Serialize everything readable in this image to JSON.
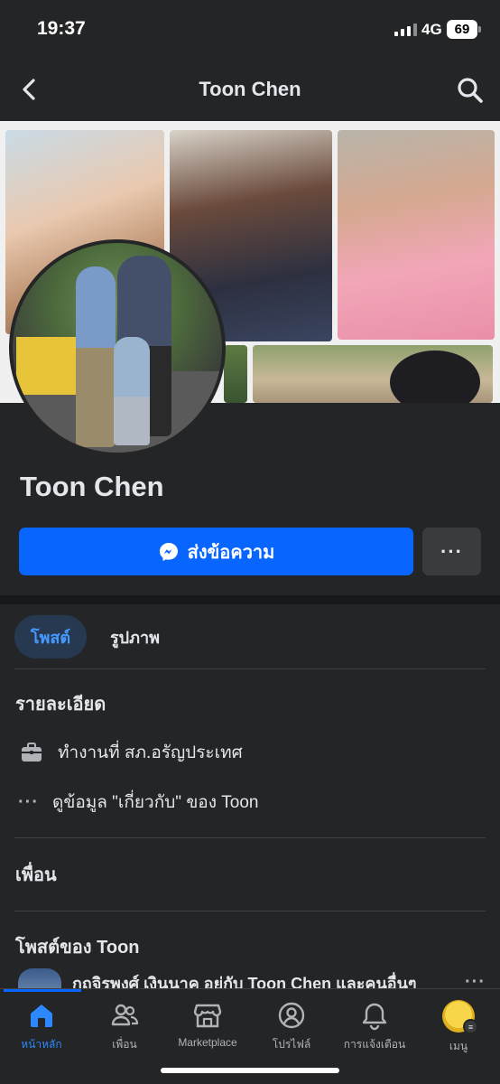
{
  "status_bar": {
    "time": "19:37",
    "network": "4G",
    "battery": "69"
  },
  "header": {
    "title": "Toon Chen",
    "back_icon": "chevron-left-icon",
    "search_icon": "search-icon"
  },
  "profile": {
    "name": "Toon Chen"
  },
  "actions": {
    "message_label": "ส่งข้อความ",
    "message_icon": "messenger-icon",
    "more_label": "···"
  },
  "tabs": [
    {
      "label": "โพสต์",
      "active": true
    },
    {
      "label": "รูปภาพ",
      "active": false
    }
  ],
  "details": {
    "title": "รายละเอียด",
    "work": "ทำงานที่ สภ.อรัญประเทศ",
    "work_icon": "briefcase-icon",
    "about_dots": "···",
    "about": "ดูข้อมูล \"เกี่ยวกับ\" ของ Toon"
  },
  "friends": {
    "title": "เพื่อน"
  },
  "posts": {
    "title": "โพสต์ของ Toon",
    "first_author": "กฤจิรพงศ์ เงินนาค อยู่กับ Toon Chen และคนอื่นๆ",
    "more": "···"
  },
  "bottom_nav": [
    {
      "label": "หน้าหลัก",
      "icon": "home-icon",
      "active": true
    },
    {
      "label": "เพื่อน",
      "icon": "friends-icon",
      "active": false
    },
    {
      "label": "Marketplace",
      "icon": "marketplace-icon",
      "active": false
    },
    {
      "label": "โปรไฟล์",
      "icon": "profile-icon",
      "active": false
    },
    {
      "label": "การแจ้งเตือน",
      "icon": "bell-icon",
      "active": false
    },
    {
      "label": "เมนู",
      "icon": "menu-avatar-icon",
      "active": false
    }
  ],
  "colors": {
    "background": "#242526",
    "accent": "#0866ff",
    "active_tab_bg": "#263951",
    "active_tab_text": "#4599ff"
  }
}
